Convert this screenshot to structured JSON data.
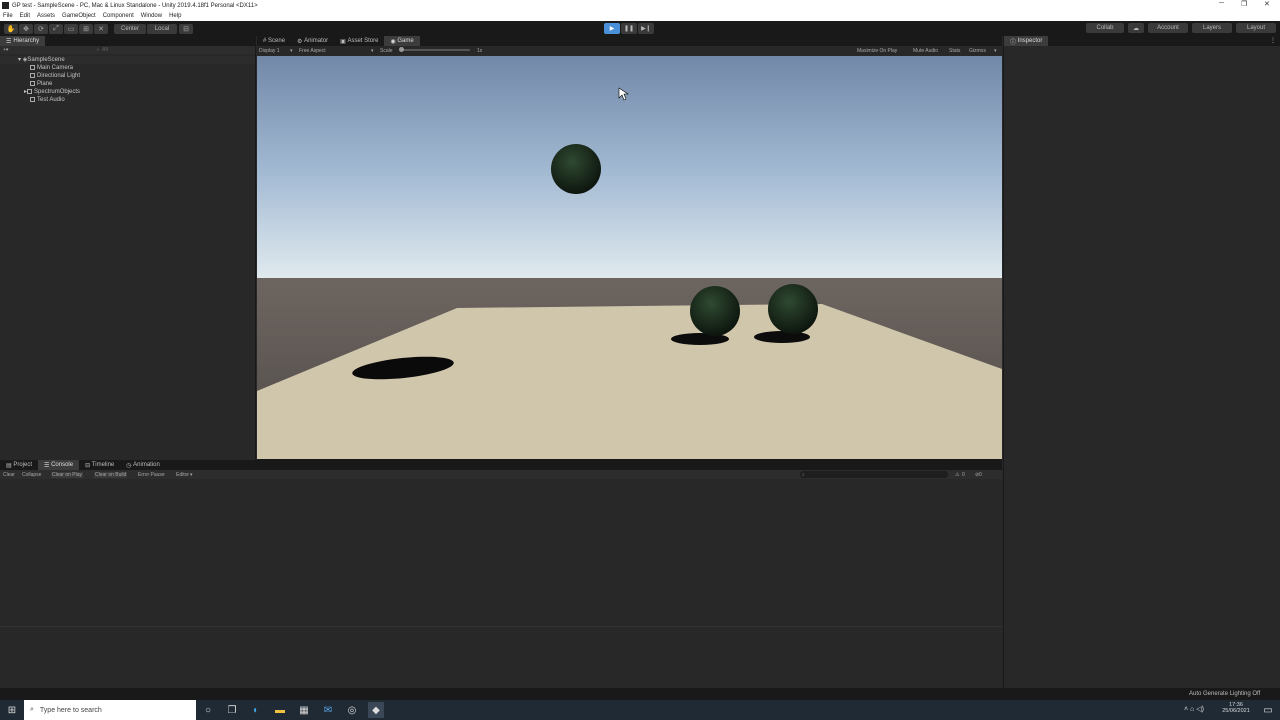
{
  "window": {
    "title": "GP test - SampleScene - PC, Mac & Linux Standalone - Unity 2019.4.18f1 Personal <DX11>",
    "minimize": "─",
    "maximize": "❐",
    "close": "✕"
  },
  "menu": [
    "File",
    "Edit",
    "Assets",
    "GameObject",
    "Component",
    "Window",
    "Help"
  ],
  "toolbar": {
    "pivot": "Center",
    "space": "Local",
    "collab": "Collab",
    "account": "Account",
    "layers": "Layers",
    "layout": "Layout"
  },
  "hierarchy": {
    "tab": "Hierarchy",
    "search_placeholder": "All",
    "scene": "SampleScene",
    "items": [
      "Main Camera",
      "Directional Light",
      "Plane",
      "SpectrumObjects",
      "Test Audio"
    ]
  },
  "center_tabs": [
    "Scene",
    "Animator",
    "Asset Store",
    "Game"
  ],
  "game_bar": {
    "display": "Display 1",
    "aspect": "Free Aspect",
    "scale_label": "Scale",
    "scale_value": "1x",
    "maximize": "Maximize On Play",
    "mute": "Mute Audio",
    "stats": "Stats",
    "gizmos": "Gizmos"
  },
  "inspector": {
    "tab": "Inspector"
  },
  "bottom_tabs": [
    "Project",
    "Console",
    "Timeline",
    "Animation"
  ],
  "console_bar": {
    "clear": "Clear",
    "collapse": "Collapse",
    "clear_on_play": "Clear on Play",
    "clear_on_build": "Clear on Build",
    "error_pause": "Error Pause",
    "editor": "Editor",
    "warn_count": "0",
    "error_count": "0"
  },
  "status": {
    "lighting": "Auto Generate Lighting Off"
  },
  "taskbar": {
    "search_placeholder": "Type here to search",
    "time": "17:36",
    "date": "25/06/2021"
  },
  "colors": {
    "sky_top": "#7188a8",
    "sky_horizon": "#dfe9ee",
    "ground": "#5e5955",
    "plane": "#cfc6ab",
    "sphere": "#1a2a1c",
    "play_active": "#4a90d9"
  }
}
